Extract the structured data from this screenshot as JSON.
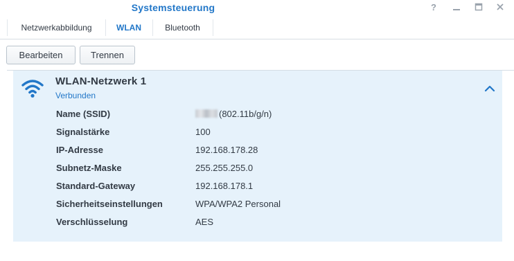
{
  "window": {
    "title": "Systemsteuerung",
    "controls": {
      "help": "?",
      "minimize": "▬",
      "maximize": "▣",
      "close": "✕"
    }
  },
  "tabs": [
    {
      "label": "Netzwerkabbildung",
      "active": false
    },
    {
      "label": "WLAN",
      "active": true
    },
    {
      "label": "Bluetooth",
      "active": false
    }
  ],
  "toolbar": {
    "edit_label": "Bearbeiten",
    "disconnect_label": "Trennen"
  },
  "network": {
    "icon": "wifi-icon",
    "name": "WLAN-Netzwerk 1",
    "status": "Verbunden",
    "expanded": true,
    "details": [
      {
        "key": "Name (SSID)",
        "value": "(802.11b/g/n)",
        "redacted_prefix": true
      },
      {
        "key": "Signalstärke",
        "value": "100"
      },
      {
        "key": "IP-Adresse",
        "value": "192.168.178.28"
      },
      {
        "key": "Subnetz-Maske",
        "value": "255.255.255.0"
      },
      {
        "key": "Standard-Gateway",
        "value": "192.168.178.1"
      },
      {
        "key": "Sicherheitseinstellungen",
        "value": "WPA/WPA2 Personal"
      },
      {
        "key": "Verschlüsselung",
        "value": "AES"
      }
    ]
  },
  "colors": {
    "accent": "#2277c8",
    "panel_bg": "#e6f2fb",
    "text": "#323a44",
    "border": "#d7dde3"
  }
}
